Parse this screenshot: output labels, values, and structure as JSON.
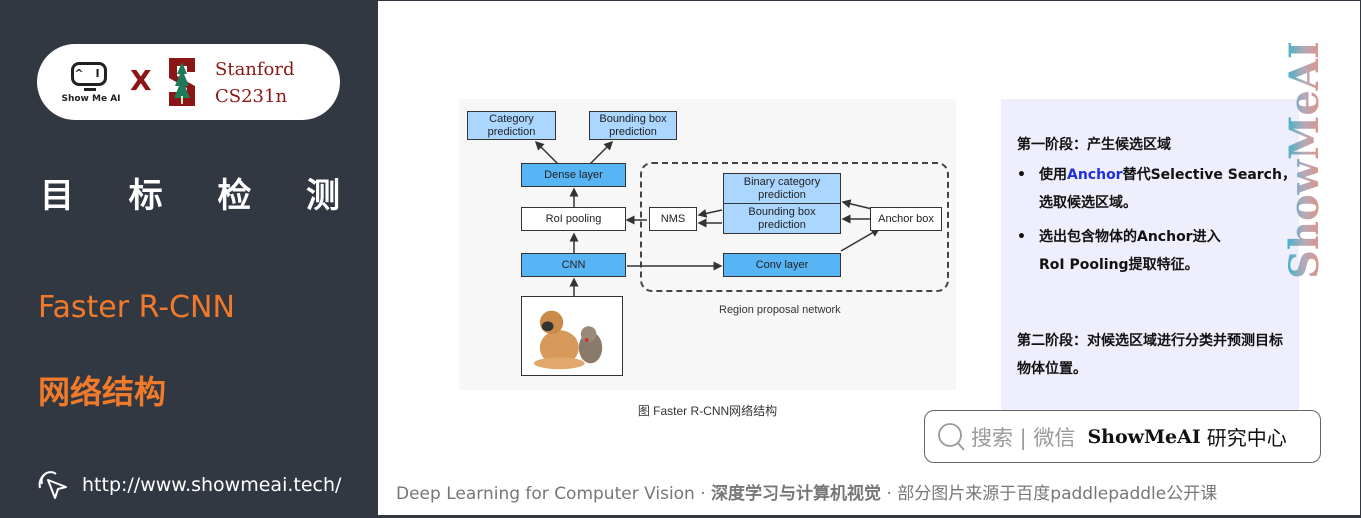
{
  "sidebar": {
    "logo": {
      "showmeai_label": "Show Me AI",
      "x_mark": "X",
      "stanford_line1": "Stanford",
      "stanford_line2": "CS231n"
    },
    "section_title_chars": [
      "目",
      "标",
      "检",
      "测"
    ],
    "topic": "Faster R-CNN",
    "subtopic": "网络结构",
    "url": "http://www.showmeai.tech/"
  },
  "diagram": {
    "boxes": {
      "category_prediction": "Category prediction",
      "bbox_prediction_top": "Bounding box prediction",
      "dense_layer": "Dense layer",
      "roi_pooling": "RoI pooling",
      "nms": "NMS",
      "binary_category": "Binary category prediction",
      "bbox_prediction_rpn": "Bounding box prediction",
      "anchor_box": "Anchor box",
      "cnn": "CNN",
      "conv_layer": "Conv layer"
    },
    "rpn_label": "Region proposal network",
    "caption": "图 Faster R-CNN网络结构"
  },
  "info": {
    "stage1_heading": "第一阶段：产生候选区域",
    "bullets": [
      {
        "pre": "使用",
        "highlight": "Anchor",
        "post": "替代Selective Search，选取候选区域。"
      },
      {
        "pre": "选出包含物体的Anchor进入RoI Pooling提取特征。",
        "highlight": "",
        "post": ""
      }
    ],
    "stage2_heading": "第二阶段：对候选区域进行分类并预测目标物体位置。",
    "highlight_color": "#1f2fe0"
  },
  "brand_vertical": "ShowMeAI",
  "search": {
    "hint": "搜索 | 微信",
    "brand": "ShowMeAI",
    "brand_suffix": "研究中心"
  },
  "footer": {
    "en": "Deep Learning for Computer Vision",
    "sep": " · ",
    "cn": "深度学习与计算机视觉",
    "note": "部分图片来源于百度paddlepaddle公开课"
  },
  "colors": {
    "sidebar_bg": "#323842",
    "accent_orange": "#f07a2a",
    "stanford_red": "#8c1515"
  }
}
